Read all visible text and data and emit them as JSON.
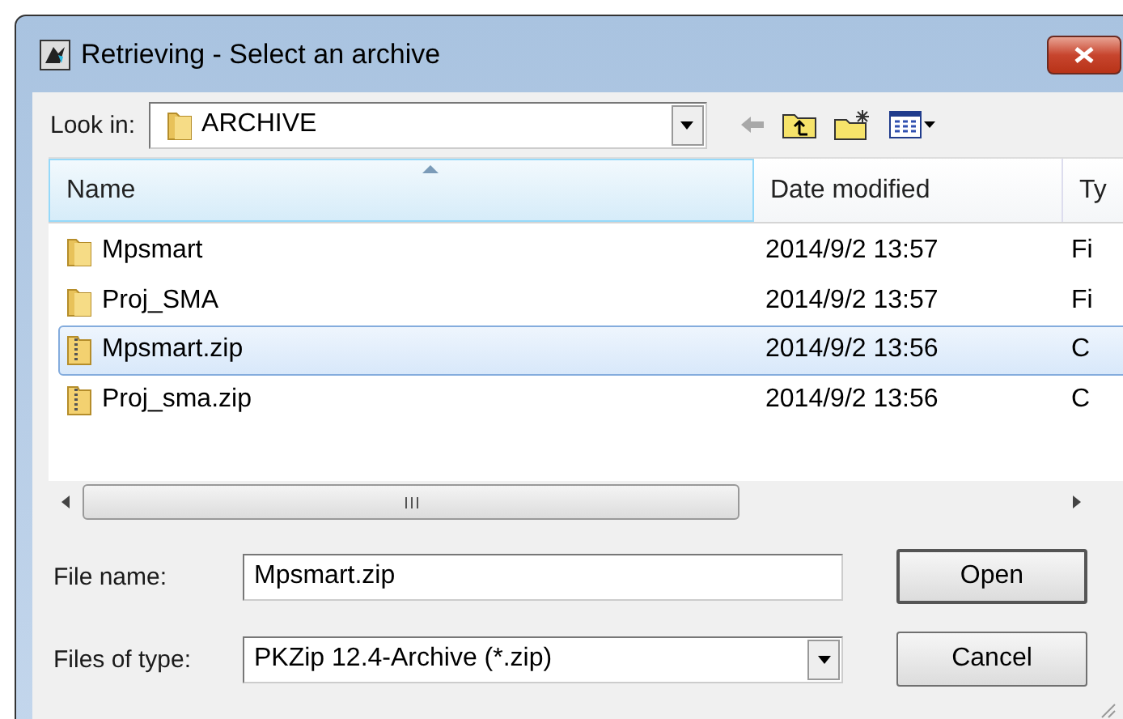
{
  "window": {
    "title": "Retrieving - Select an archive"
  },
  "look_in": {
    "label": "Look in:",
    "value": "ARCHIVE"
  },
  "columns": [
    {
      "label": "Name",
      "sorted": true
    },
    {
      "label": "Date modified",
      "sorted": false
    },
    {
      "label": "Ty",
      "sorted": false
    }
  ],
  "rows": [
    {
      "kind": "folder",
      "name": "Mpsmart",
      "date": "2014/9/2 13:57",
      "type": "Fi",
      "selected": false
    },
    {
      "kind": "folder",
      "name": "Proj_SMA",
      "date": "2014/9/2 13:57",
      "type": "Fi",
      "selected": false
    },
    {
      "kind": "zip",
      "name": "Mpsmart.zip",
      "date": "2014/9/2 13:56",
      "type": "C",
      "selected": true
    },
    {
      "kind": "zip",
      "name": "Proj_sma.zip",
      "date": "2014/9/2 13:56",
      "type": "C",
      "selected": false
    }
  ],
  "file_name": {
    "label": "File name:",
    "value": "Mpsmart.zip"
  },
  "file_type": {
    "label": "Files of type:",
    "value": "PKZip 12.4-Archive (*.zip)"
  },
  "buttons": [
    "Open",
    "Cancel"
  ]
}
